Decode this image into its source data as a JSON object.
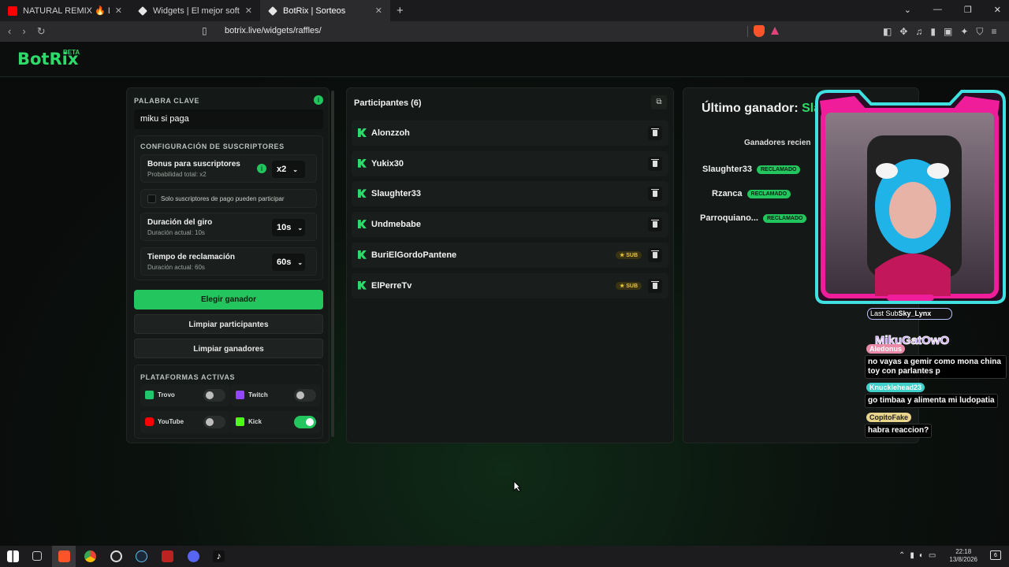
{
  "browser": {
    "tabs": [
      {
        "title": "NATURAL REMIX 🔥 DOBLE TONO 🔥",
        "color": "#ff0000"
      },
      {
        "title": "Widgets | El mejor software para pot",
        "color": "#e6e6e6"
      },
      {
        "title": "BotRix | Sorteos",
        "color": "#e6e6e6"
      }
    ],
    "url": "botrix.live/widgets/raffles/"
  },
  "app": {
    "logo": "BotRix",
    "beta": "BETA"
  },
  "settings": {
    "keyword_label": "PALABRA CLAVE",
    "keyword_value": "miku si paga",
    "sub_config_label": "CONFIGURACIÓN DE SUSCRIPTORES",
    "bonus_title": "Bonus para suscriptores",
    "bonus_sub": "Probabilidad total: x2",
    "bonus_value": "x2",
    "only_subs_label": "Solo suscriptores de pago pueden participar",
    "spin_title": "Duración del giro",
    "spin_sub": "Duración actual: 10s",
    "spin_value": "10s",
    "claim_title": "Tiempo de reclamación",
    "claim_sub": "Duración actual: 60s",
    "claim_value": "60s",
    "pick_winner": "Elegir ganador",
    "clear_participants": "Limpiar participantes",
    "clear_winners": "Limpiar ganadores",
    "platforms_label": "PLATAFORMAS ACTIVAS",
    "platforms": [
      {
        "name": "Trovo",
        "on": false,
        "color": "#1fc66e"
      },
      {
        "name": "Twitch",
        "on": false,
        "color": "#9146ff"
      },
      {
        "name": "YouTube",
        "on": false,
        "color": "#ff0000"
      },
      {
        "name": "Kick",
        "on": true,
        "color": "#53fc18"
      }
    ]
  },
  "participants": {
    "title": "Participantes (6)",
    "list": [
      {
        "name": "Alonzzoh",
        "sub": ""
      },
      {
        "name": "Yukix30",
        "sub": ""
      },
      {
        "name": "Slaughter33",
        "sub": ""
      },
      {
        "name": "Undmebabe",
        "sub": ""
      },
      {
        "name": "BuriElGordoPantene",
        "sub": "★ SUB"
      },
      {
        "name": "ElPerreTv",
        "sub": "★ SUB"
      }
    ]
  },
  "winners": {
    "title": "Último ganador:",
    "title_name": "Sla",
    "recent_label": "Ganadores recien",
    "list": [
      {
        "name": "Slaughter33",
        "badge": "RECLAMADO"
      },
      {
        "name": "Rzanca",
        "badge": "RECLAMADO"
      },
      {
        "name": "Parroquiano...",
        "badge": "RECLAMADO"
      }
    ]
  },
  "overlay": {
    "last_sub_label": "Last Sub",
    "last_sub_name": "Sky_Lynx",
    "brand": "MikuGatOwO",
    "chat": [
      {
        "user": "Aledonus",
        "text": "no vayas a gemir como mona china toy con parlantes p",
        "color": "#e88aa8"
      },
      {
        "user": "Knucklehead23",
        "text": "go timbaa y alimenta mi ludopatia",
        "color": "#3fd0c9"
      },
      {
        "user": "CopitoFake",
        "text": "habra reaccion?",
        "color": "#e8d48a"
      }
    ]
  },
  "taskbar": {
    "time": "22:18",
    "date": "13/8/2026",
    "notif": "6"
  }
}
